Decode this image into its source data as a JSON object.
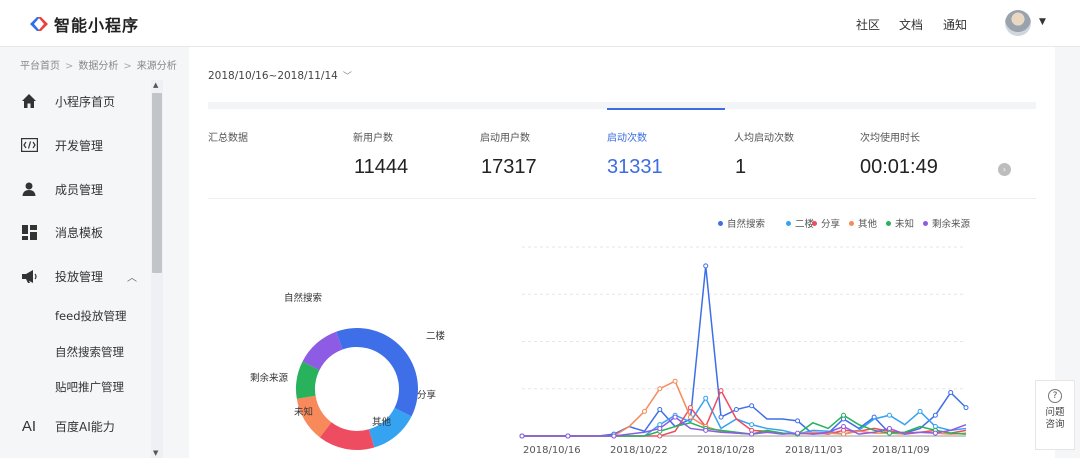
{
  "header": {
    "app_name": "智能小程序",
    "nav": [
      "社区",
      "文档",
      "通知"
    ],
    "logo_colors": [
      "#2f6fec",
      "#e8413b"
    ]
  },
  "breadcrumb": [
    "平台首页",
    "数据分析",
    "来源分析"
  ],
  "sidebar": {
    "items": [
      {
        "label": "小程序首页",
        "icon": "home-icon"
      },
      {
        "label": "开发管理",
        "icon": "code-icon"
      },
      {
        "label": "成员管理",
        "icon": "user-icon"
      },
      {
        "label": "消息模板",
        "icon": "template-icon"
      },
      {
        "label": "投放管理",
        "icon": "megaphone-icon"
      }
    ],
    "sub_items": [
      "feed投放管理",
      "自然搜索管理",
      "贴吧推广管理"
    ],
    "ai_item": {
      "icon_text": "AI",
      "label": "百度AI能力"
    }
  },
  "main": {
    "date_range": "2018/10/16~2018/11/14",
    "summary_label": "汇总数据",
    "metrics": [
      {
        "label": "新用户数",
        "value": "11444"
      },
      {
        "label": "启动用户数",
        "value": "17317"
      },
      {
        "label": "启动次数",
        "value": "31331",
        "active": true
      },
      {
        "label": "人均启动次数",
        "value": "1"
      },
      {
        "label": "次均使用时长",
        "value": "00:01:49"
      }
    ],
    "accent_color": "#3d6de0"
  },
  "chart_data": [
    {
      "type": "pie",
      "style": "donut",
      "slices": [
        {
          "name": "自然搜索",
          "value": 38,
          "color": "#3e6fe8"
        },
        {
          "name": "二楼",
          "value": 13,
          "color": "#36a3f0"
        },
        {
          "name": "分享",
          "value": 15,
          "color": "#ee4c60"
        },
        {
          "name": "其他",
          "value": 12,
          "color": "#f7895a"
        },
        {
          "name": "未知",
          "value": 10,
          "color": "#27b25b"
        },
        {
          "name": "剩余来源",
          "value": 12,
          "color": "#8e5be4"
        }
      ]
    },
    {
      "type": "line",
      "legend_position": "top-right",
      "grid": true,
      "x_ticks": [
        "2018/10/16",
        "2018/10/22",
        "2018/10/28",
        "2018/11/03",
        "2018/11/09"
      ],
      "x": [
        "2018/10/16",
        "2018/10/17",
        "2018/10/18",
        "2018/10/19",
        "2018/10/20",
        "2018/10/21",
        "2018/10/22",
        "2018/10/23",
        "2018/10/24",
        "2018/10/25",
        "2018/10/26",
        "2018/10/27",
        "2018/10/28",
        "2018/10/29",
        "2018/10/30",
        "2018/10/31",
        "2018/11/01",
        "2018/11/02",
        "2018/11/03",
        "2018/11/04",
        "2018/11/05",
        "2018/11/06",
        "2018/11/07",
        "2018/11/08",
        "2018/11/09",
        "2018/11/10",
        "2018/11/11",
        "2018/11/12",
        "2018/11/13",
        "2018/11/14"
      ],
      "ylim": [
        0,
        200
      ],
      "series": [
        {
          "name": "自然搜索",
          "color": "#3e6fe8",
          "values": [
            0,
            0,
            0,
            0,
            0,
            0,
            2,
            10,
            5,
            28,
            10,
            18,
            180,
            20,
            28,
            32,
            18,
            18,
            16,
            2,
            3,
            18,
            8,
            20,
            3,
            3,
            8,
            22,
            46,
            30
          ]
        },
        {
          "name": "二楼",
          "color": "#36a3f0",
          "values": [
            0,
            0,
            0,
            0,
            0,
            0,
            0,
            0,
            0,
            12,
            22,
            15,
            40,
            8,
            18,
            12,
            8,
            6,
            2,
            6,
            5,
            2,
            6,
            18,
            22,
            12,
            26,
            10,
            6,
            8
          ]
        },
        {
          "name": "分享",
          "color": "#ee4c60",
          "values": [
            0,
            0,
            0,
            0,
            0,
            0,
            0,
            0,
            0,
            0,
            5,
            30,
            10,
            48,
            18,
            6,
            5,
            3,
            2,
            4,
            2,
            6,
            5,
            8,
            5,
            3,
            4,
            6,
            3,
            6
          ]
        },
        {
          "name": "其他",
          "color": "#f7895a",
          "values": [
            0,
            0,
            0,
            0,
            0,
            0,
            0,
            10,
            26,
            50,
            58,
            20,
            10,
            5,
            3,
            2,
            4,
            3,
            2,
            4,
            3,
            2,
            5,
            3,
            3,
            2,
            4,
            3,
            2,
            3
          ]
        },
        {
          "name": "未知",
          "color": "#27b25b",
          "values": [
            0,
            0,
            0,
            0,
            0,
            0,
            0,
            0,
            0,
            5,
            10,
            14,
            8,
            6,
            4,
            2,
            6,
            3,
            2,
            14,
            8,
            22,
            12,
            6,
            3,
            4,
            10,
            6,
            3,
            2
          ]
        },
        {
          "name": "剩余来源",
          "color": "#8e5be4",
          "values": [
            0,
            0,
            0,
            0,
            0,
            0,
            0,
            2,
            4,
            8,
            20,
            8,
            6,
            4,
            3,
            2,
            4,
            2,
            3,
            2,
            4,
            10,
            2,
            4,
            8,
            2,
            4,
            3,
            6,
            12
          ]
        }
      ]
    }
  ],
  "help": {
    "line1": "问题",
    "line2": "咨询"
  }
}
